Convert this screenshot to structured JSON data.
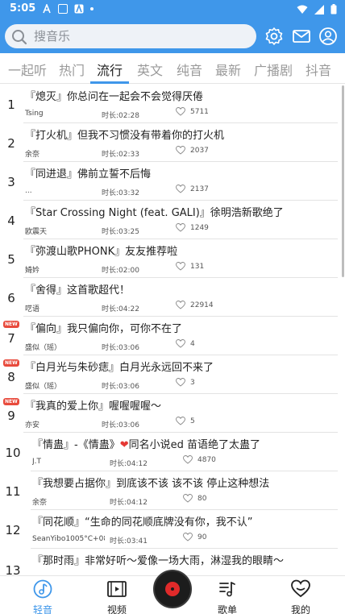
{
  "status": {
    "time": "5:05"
  },
  "search": {
    "placeholder": "搜音乐"
  },
  "tabs": [
    {
      "label": "一起听"
    },
    {
      "label": "热门"
    },
    {
      "label": "流行"
    },
    {
      "label": "英文"
    },
    {
      "label": "纯音"
    },
    {
      "label": "最新"
    },
    {
      "label": "广播剧"
    },
    {
      "label": "抖音"
    }
  ],
  "active_tab": "流行",
  "new_badge": "NEW",
  "duration_prefix": "时长:",
  "songs": [
    {
      "rank": "1",
      "title": "『熄灭』你总问在一起会不会觉得厌倦",
      "artist": "Tsing",
      "duration": "时长:02:28",
      "likes": "5711"
    },
    {
      "rank": "2",
      "title": "『打火机』但我不习惯没有带着你的打火机",
      "artist": "余奈",
      "duration": "时长:02:33",
      "likes": "2037"
    },
    {
      "rank": "3",
      "title": "『同进退』佛前立誓不后悔",
      "artist": "...",
      "duration": "时长:03:32",
      "likes": "2137"
    },
    {
      "rank": "4",
      "title": "『Star Crossing Night (feat. GALI)』徐明浩新歌绝了",
      "artist": "欧震天",
      "duration": "时长:03:25",
      "likes": "1249"
    },
    {
      "rank": "5",
      "title": "『弥渡山歌PHONK』友友推荐啦",
      "artist": "婍妗",
      "duration": "时长:02:00",
      "likes": "131"
    },
    {
      "rank": "6",
      "title": "『舍得』这首歌超代！",
      "artist": "呓语",
      "duration": "时长:04:22",
      "likes": "22914"
    },
    {
      "rank": "7",
      "title": "『偏向』我只偏向你，可你不在了",
      "artist": "盛似（瑶）",
      "duration": "时长:03:06",
      "likes": "4",
      "is_new": true
    },
    {
      "rank": "8",
      "title": "『白月光与朱砂痣』白月光永远回不来了",
      "artist": "盛似（瑶）",
      "duration": "时长:03:06",
      "likes": "3",
      "is_new": true
    },
    {
      "rank": "9",
      "title": "『我真的爱上你』喔喔喔喔～",
      "artist": "亦安",
      "duration": "时长:03:06",
      "likes": "5",
      "is_new": true
    },
    {
      "rank": "10",
      "title": "『情蛊』-《情蛊》",
      "title_after_heart": "同名小说ed 苗语绝了太蛊了",
      "artist": "J.T",
      "duration": "时长:04:12",
      "likes": "4870"
    },
    {
      "rank": "11",
      "title": "『我想要占据你』到底该不该 该不该 停止这种想法",
      "artist": "余奈",
      "duration": "时长:04:12",
      "likes": "80"
    },
    {
      "rank": "12",
      "title": "『同花顺』“生命的同花顺底牌没有你，我不认”",
      "artist": "SeanYibo1005°C+08...",
      "duration": "时长:03:41",
      "likes": "90"
    },
    {
      "rank": "13",
      "title": "『那时雨』非常好听～爱像一场大雨，淋湿我的眼睛～",
      "artist": "",
      "duration": "",
      "likes": ""
    }
  ],
  "bottom_nav": [
    {
      "label": "轻音",
      "icon": "music-note-icon"
    },
    {
      "label": "视频",
      "icon": "video-icon"
    },
    {
      "label": "歌单",
      "icon": "playlist-icon"
    },
    {
      "label": "我的",
      "icon": "heart-icon"
    }
  ],
  "colors": {
    "accent": "#3f97ea",
    "new_badge": "#e84a3c",
    "heart": "#e53935"
  }
}
